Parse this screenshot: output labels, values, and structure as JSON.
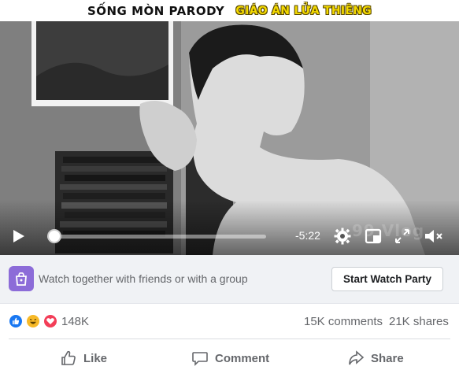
{
  "title": {
    "main": "SỐNG MÒN PARODY",
    "highlight": "GIÁO ÁN LỬA THIÊNG"
  },
  "player": {
    "time_remaining": "-5:22",
    "progress": 0.02,
    "watermark": "99 Vlog",
    "icons": [
      "play-icon",
      "gear-icon",
      "picture-in-picture-icon",
      "fullscreen-icon",
      "volume-muted-icon"
    ]
  },
  "watch_party": {
    "prompt": "Watch together with friends or with a group",
    "button_label": "Start Watch Party",
    "accent": "#8c6cd8"
  },
  "stats": {
    "reactions_count": "148K",
    "reactions": [
      "like",
      "haha",
      "love"
    ],
    "comments": "15K comments",
    "shares": "21K shares"
  },
  "actions": {
    "like": "Like",
    "comment": "Comment",
    "share": "Share"
  },
  "colors": {
    "like_blue": "#1877f2",
    "love_red": "#f33e58",
    "haha_yellow": "#f7b928",
    "muted_text": "#65676b"
  }
}
